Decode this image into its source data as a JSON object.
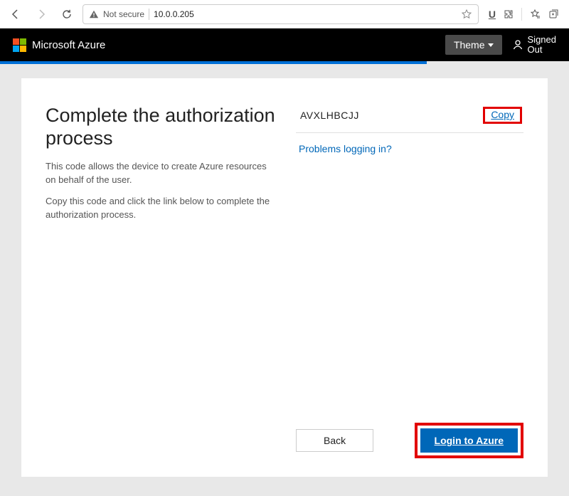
{
  "browser": {
    "security_label": "Not secure",
    "url": "10.0.0.205"
  },
  "azure": {
    "brand": "Microsoft Azure",
    "theme_label": "Theme",
    "signin_status_line1": "Signed",
    "signin_status_line2": "Out"
  },
  "page": {
    "heading": "Complete the authorization process",
    "para1": "This code allows the device to create Azure resources on behalf of the user.",
    "para2": "Copy this code and click the link below to complete the authorization process."
  },
  "auth": {
    "code": "AVXLHBCJJ",
    "copy_label": "Copy",
    "problems_label": "Problems logging in?",
    "back_label": "Back",
    "login_label": "Login to Azure"
  }
}
